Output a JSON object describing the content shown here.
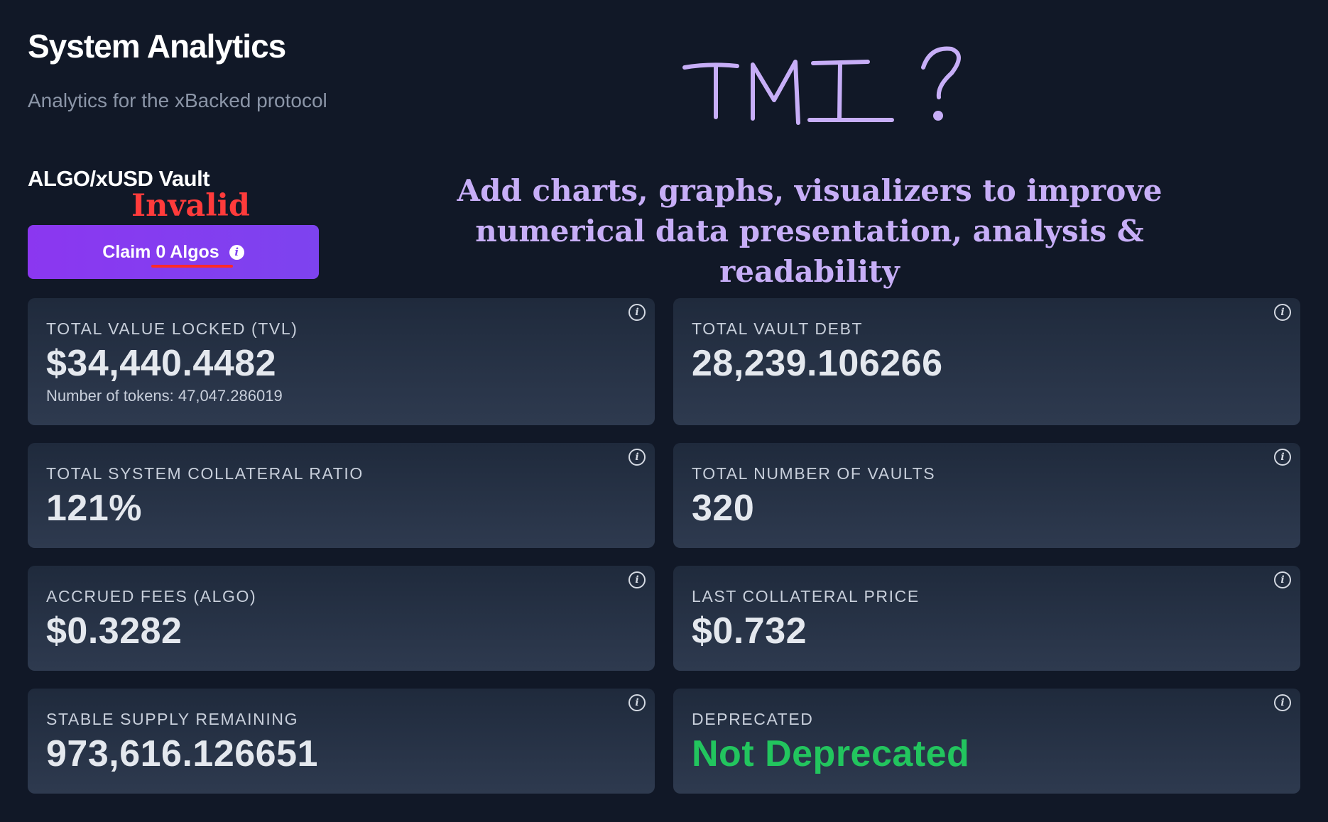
{
  "header": {
    "title": "System Analytics",
    "subtitle": "Analytics for the xBacked protocol"
  },
  "vault": {
    "name": "ALGO/xUSD Vault",
    "claim_button": {
      "prefix": "Claim ",
      "amount": "0",
      "suffix": " Algos",
      "info_icon": "info-icon"
    }
  },
  "annotations": {
    "invalid": "Invalid",
    "tmi": "TMI ?",
    "suggestion_line1": "Add charts, graphs, visualizers to improve",
    "suggestion_line2": "numerical data presentation, analysis & readability",
    "colors": {
      "invalid": "#ff3b3b",
      "underline": "#ff2a2a",
      "suggestion": "#c7aef7"
    }
  },
  "stats": [
    {
      "label": "TOTAL VALUE LOCKED (TVL)",
      "value": "$34,440.4482",
      "sub": "Number of tokens: 47,047.286019"
    },
    {
      "label": "TOTAL VAULT DEBT",
      "value": "28,239.106266"
    },
    {
      "label": "TOTAL SYSTEM COLLATERAL RATIO",
      "value": "121%"
    },
    {
      "label": "TOTAL NUMBER OF VAULTS",
      "value": "320"
    },
    {
      "label": "ACCRUED FEES (ALGO)",
      "value": "$0.3282"
    },
    {
      "label": "LAST COLLATERAL PRICE",
      "value": "$0.732"
    },
    {
      "label": "STABLE SUPPLY REMAINING",
      "value": "973,616.126651"
    },
    {
      "label": "DEPRECATED",
      "value": "Not Deprecated",
      "value_color": "#22c55e"
    }
  ],
  "colors": {
    "background": "#111827",
    "card": "#2a3547",
    "accent": "#8b37f0",
    "positive": "#22c55e"
  }
}
